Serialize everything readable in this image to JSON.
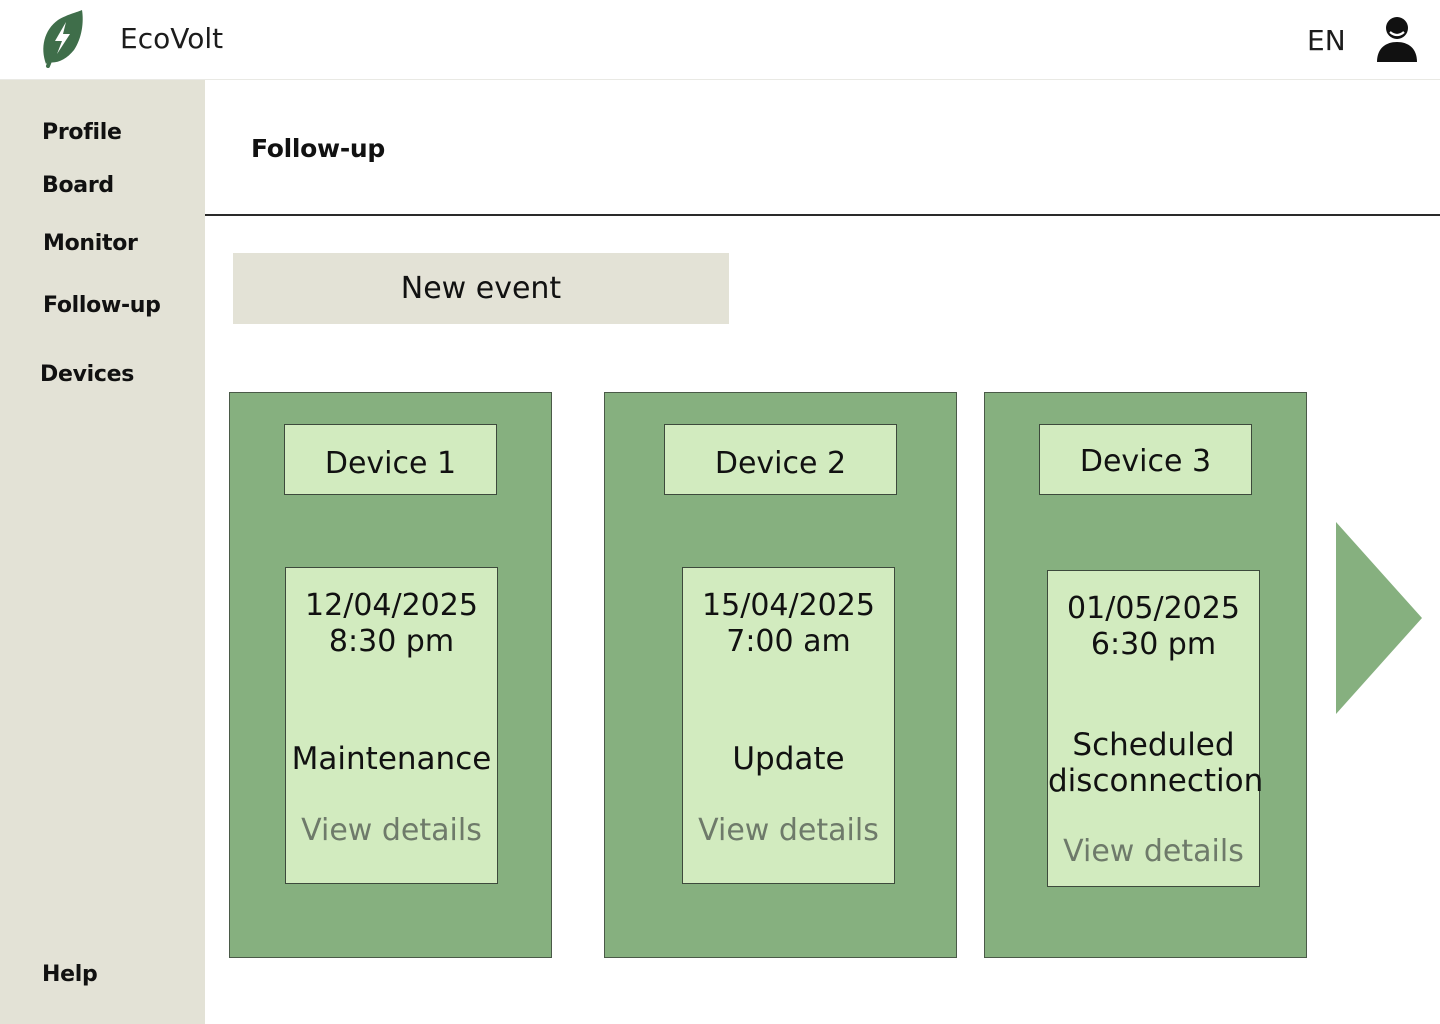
{
  "app": {
    "name": "EcoVolt",
    "logo_icon": "leaf-bolt-icon",
    "language": "EN",
    "user_icon": "user-icon",
    "brand_color": "#3f6e4a"
  },
  "sidebar": {
    "items": [
      {
        "label": "Profile"
      },
      {
        "label": "Board"
      },
      {
        "label": "Monitor"
      },
      {
        "label": "Follow-up"
      },
      {
        "label": "Devices"
      }
    ],
    "help_label": "Help",
    "background": "#e3e2d6"
  },
  "main": {
    "title": "Follow-up",
    "new_event_label": "New event",
    "cards": [
      {
        "device": "Device 1",
        "date": "12/04/2025",
        "time": "8:30 pm",
        "event": "Maintenance",
        "link": "View details"
      },
      {
        "device": "Device 2",
        "date": "15/04/2025",
        "time": "7:00 am",
        "event": "Update",
        "link": "View details"
      },
      {
        "device": "Device 3",
        "date": "01/05/2025",
        "time": "6:30 pm",
        "event_line1": "Scheduled",
        "event_line2": "disconnection",
        "link": "View details"
      }
    ],
    "next_icon": "chevron-right-icon",
    "card_color": "#86b07f",
    "inner_color": "#d2ebbf"
  }
}
